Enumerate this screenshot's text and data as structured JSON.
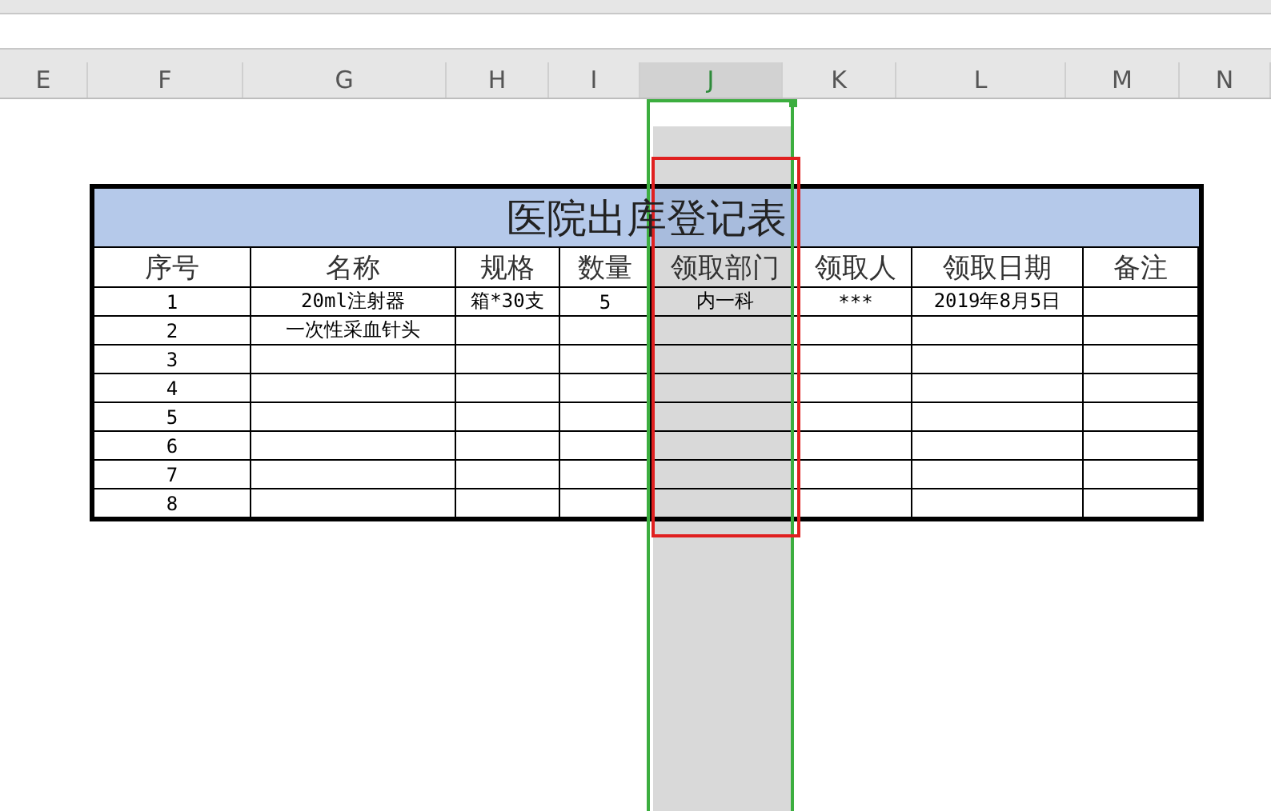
{
  "column_headers": [
    {
      "label": "E",
      "selected": false
    },
    {
      "label": "F",
      "selected": false
    },
    {
      "label": "G",
      "selected": false
    },
    {
      "label": "H",
      "selected": false
    },
    {
      "label": "I",
      "selected": false
    },
    {
      "label": "J",
      "selected": true
    },
    {
      "label": "K",
      "selected": false
    },
    {
      "label": "L",
      "selected": false
    },
    {
      "label": "M",
      "selected": false
    },
    {
      "label": "N",
      "selected": false
    }
  ],
  "table": {
    "title": "医院出库登记表",
    "columns": [
      "序号",
      "名称",
      "规格",
      "数量",
      "领取部门",
      "领取人",
      "领取日期",
      "备注"
    ],
    "rows": [
      [
        "1",
        "20ml注射器",
        "箱*30支",
        "5",
        "内一科",
        "***",
        "2019年8月5日",
        ""
      ],
      [
        "2",
        "一次性采血针头",
        "",
        "",
        "",
        "",
        "",
        ""
      ],
      [
        "3",
        "",
        "",
        "",
        "",
        "",
        "",
        ""
      ],
      [
        "4",
        "",
        "",
        "",
        "",
        "",
        "",
        ""
      ],
      [
        "5",
        "",
        "",
        "",
        "",
        "",
        "",
        ""
      ],
      [
        "6",
        "",
        "",
        "",
        "",
        "",
        "",
        ""
      ],
      [
        "7",
        "",
        "",
        "",
        "",
        "",
        "",
        ""
      ],
      [
        "8",
        "",
        "",
        "",
        "",
        "",
        "",
        ""
      ]
    ]
  }
}
